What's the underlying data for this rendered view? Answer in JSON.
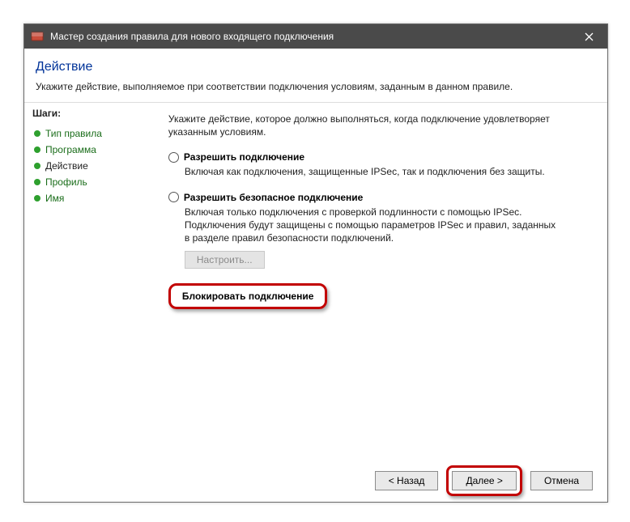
{
  "titlebar": {
    "title": "Мастер создания правила для нового входящего подключения"
  },
  "header": {
    "title": "Действие",
    "subtitle": "Укажите действие, выполняемое при соответствии подключения условиям, заданным в данном правиле."
  },
  "sidebar": {
    "title": "Шаги:",
    "steps": [
      {
        "label": "Тип правила",
        "current": false
      },
      {
        "label": "Программа",
        "current": false
      },
      {
        "label": "Действие",
        "current": true
      },
      {
        "label": "Профиль",
        "current": false
      },
      {
        "label": "Имя",
        "current": false
      }
    ]
  },
  "main": {
    "instruction": "Укажите действие, которое должно выполняться, когда подключение удовлетворяет указанным условиям.",
    "options": {
      "allow": {
        "label": "Разрешить подключение",
        "desc": "Включая как подключения, защищенные IPSec, так и подключения без защиты."
      },
      "allow_secure": {
        "label": "Разрешить безопасное подключение",
        "desc": "Включая только подключения с проверкой подлинности с помощью IPSec. Подключения будут защищены с помощью параметров IPSec и правил, заданных в разделе правил безопасности подключений.",
        "configure_btn": "Настроить..."
      },
      "block": {
        "label": "Блокировать подключение"
      }
    },
    "selected": "block"
  },
  "footer": {
    "back": "< Назад",
    "next": "Далее >",
    "cancel": "Отмена"
  }
}
